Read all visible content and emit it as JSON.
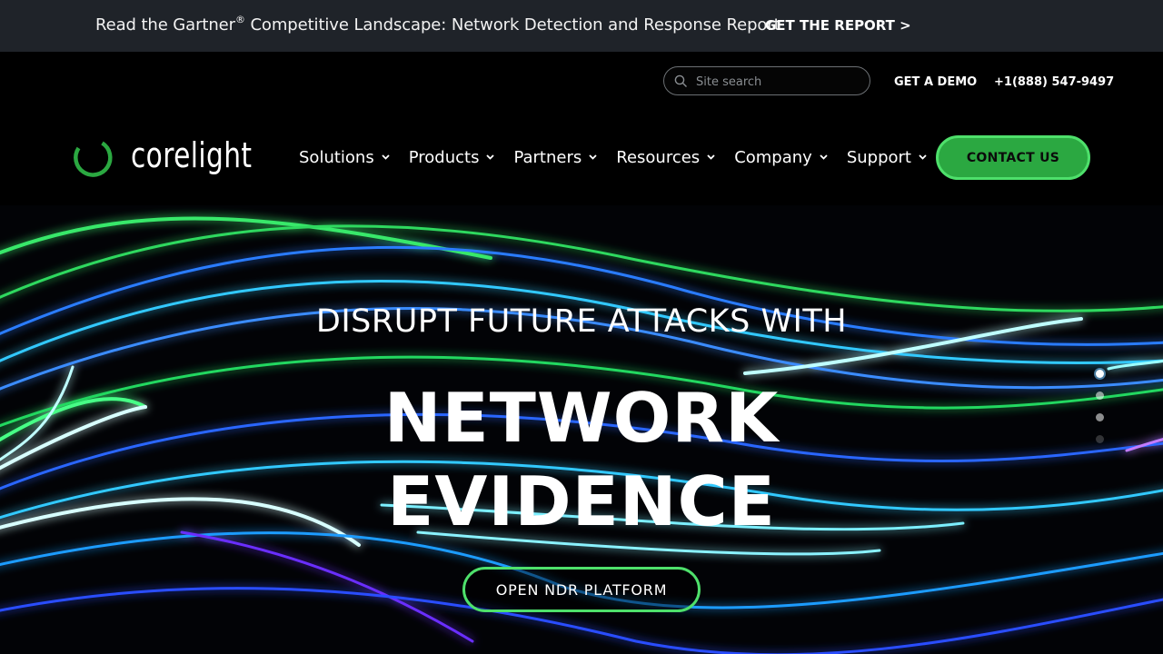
{
  "announcement": {
    "text_before": "Read the Gartner",
    "registered_mark": "®",
    "text_after": " Competitive Landscape: Network Detection and Response Report",
    "cta": "GET THE REPORT >"
  },
  "utility": {
    "search_placeholder": "Site search",
    "demo_label": "GET A DEMO",
    "phone": "+1(888) 547-9497"
  },
  "brand": {
    "name": "corelight",
    "accent_color": "#2ba841"
  },
  "nav": {
    "items": [
      {
        "label": "Solutions"
      },
      {
        "label": "Products"
      },
      {
        "label": "Partners"
      },
      {
        "label": "Resources"
      },
      {
        "label": "Company"
      },
      {
        "label": "Support"
      }
    ],
    "contact_label": "CONTACT US"
  },
  "hero": {
    "eyebrow": "DISRUPT FUTURE ATTACKS WITH",
    "title_line1": "NETWORK",
    "title_line2": "EVIDENCE",
    "cta": "OPEN NDR PLATFORM",
    "slides": [
      true,
      false,
      false,
      false
    ]
  }
}
